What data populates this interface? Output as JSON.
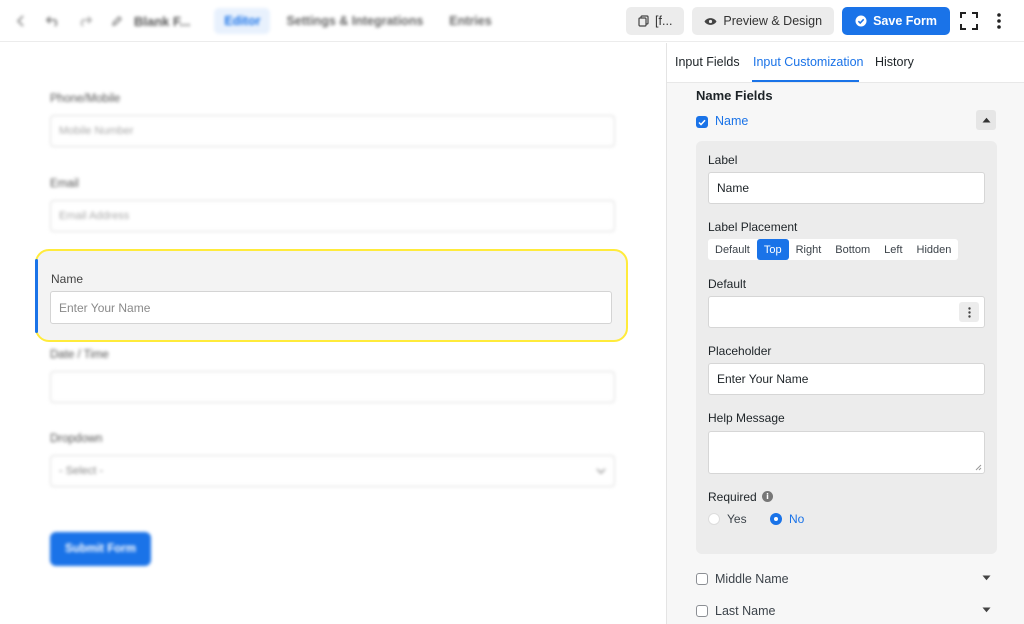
{
  "header": {
    "back_icon": "chevron-left-icon",
    "undo_icon": "undo-icon",
    "redo_icon": "redo-icon",
    "form_title": "Blank F...",
    "nav_tabs": [
      {
        "label": "Editor",
        "active": true
      },
      {
        "label": "Settings & Integrations",
        "active": false
      },
      {
        "label": "Entries",
        "active": false
      }
    ],
    "shortcode_label": "[f...",
    "preview_label": "Preview & Design",
    "save_label": "Save Form",
    "accent_color": "#1a73e8"
  },
  "canvas": {
    "fields": [
      {
        "label": "Phone/Mobile",
        "placeholder": "Mobile Number"
      },
      {
        "label": "Email",
        "placeholder": "Email Address"
      },
      {
        "label": "Date / Time",
        "placeholder": ""
      },
      {
        "label": "Dropdown",
        "placeholder": "- Select -"
      }
    ],
    "selected_field": {
      "label": "Name",
      "placeholder": "Enter Your Name",
      "highlight_color": "#ffeb3b"
    },
    "submit_label": "Submit Form"
  },
  "panel": {
    "tabs": [
      {
        "label": "Input Fields",
        "active": false
      },
      {
        "label": "Input Customization",
        "active": true
      },
      {
        "label": "History",
        "active": false
      }
    ],
    "section_title": "Name Fields",
    "name_row": {
      "label": "Name",
      "checked": true
    },
    "label_field": {
      "label": "Label",
      "value": "Name"
    },
    "label_placement": {
      "label": "Label Placement",
      "options": [
        "Default",
        "Top",
        "Right",
        "Bottom",
        "Left",
        "Hidden"
      ],
      "selected": "Top"
    },
    "default_field": {
      "label": "Default",
      "value": ""
    },
    "placeholder_field": {
      "label": "Placeholder",
      "value": "Enter Your Name"
    },
    "help_field": {
      "label": "Help Message",
      "value": ""
    },
    "required": {
      "label": "Required",
      "options": [
        "Yes",
        "No"
      ],
      "selected": "No"
    },
    "middle_name_row": {
      "label": "Middle Name",
      "checked": false
    },
    "last_name_row": {
      "label": "Last Name",
      "checked": false
    }
  }
}
